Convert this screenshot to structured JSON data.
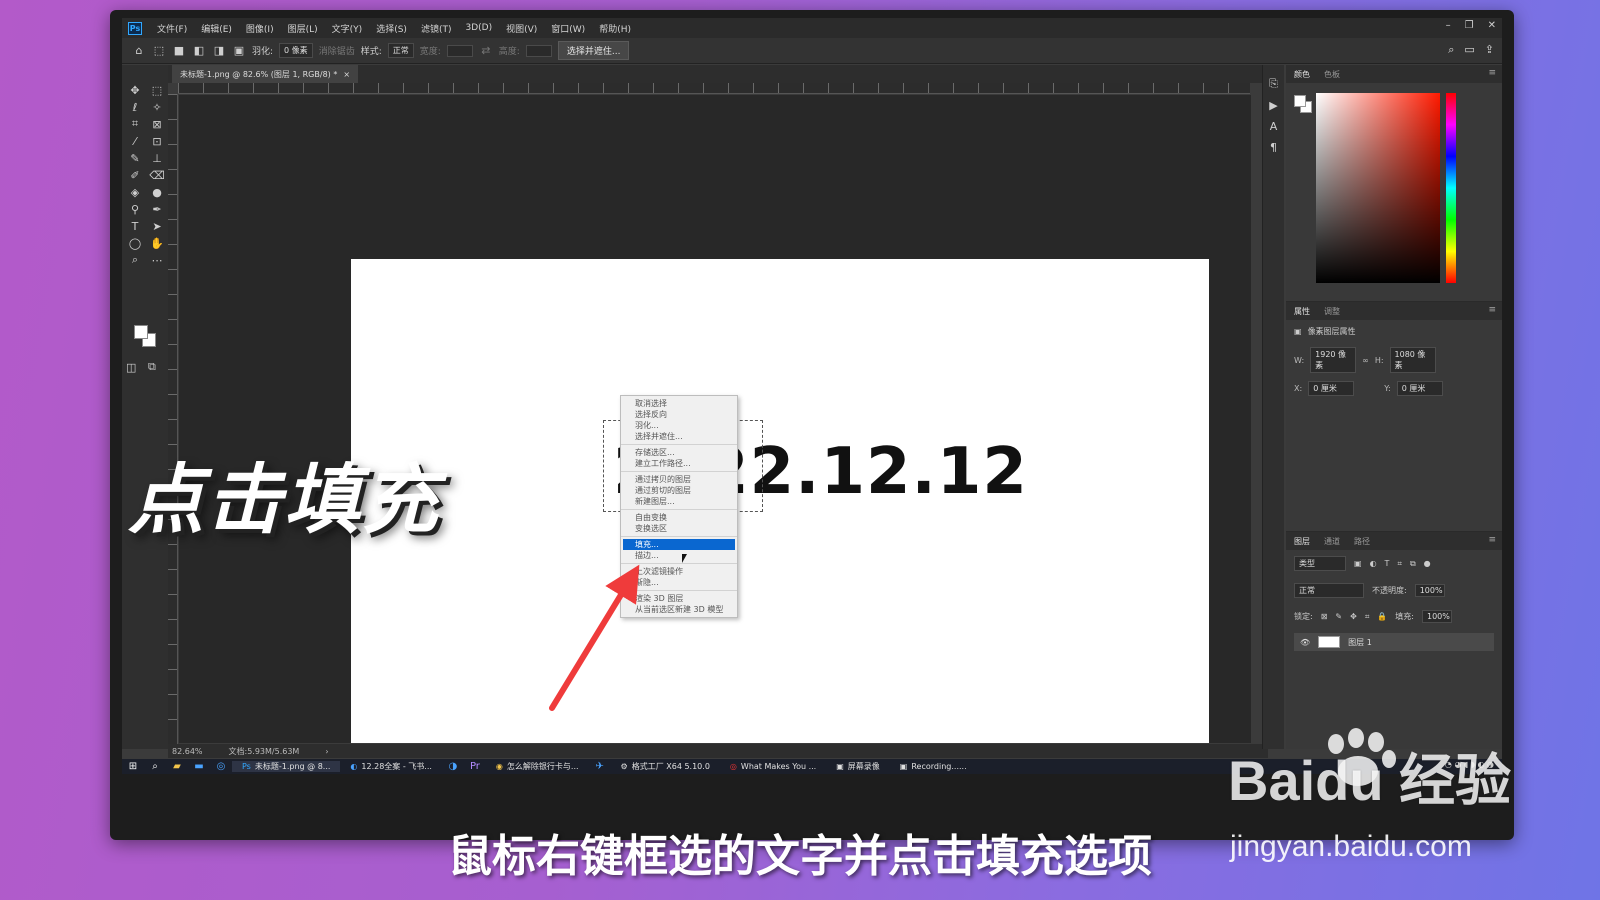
{
  "app": {
    "logo_text": "Ps",
    "menu": [
      "文件(F)",
      "编辑(E)",
      "图像(I)",
      "图层(L)",
      "文字(Y)",
      "选择(S)",
      "滤镜(T)",
      "3D(D)",
      "视图(V)",
      "窗口(W)",
      "帮助(H)"
    ]
  },
  "options_bar": {
    "feather_label": "羽化:",
    "feather_value": "0 像素",
    "antialias_label": "消除锯齿",
    "style_label": "样式:",
    "style_value": "正常",
    "width_label": "宽度:",
    "height_label": "高度:",
    "select_mask_button": "选择并遮住..."
  },
  "document": {
    "tab_title": "未标题-1.png @ 82.6% (图层 1, RGB/8) *",
    "canvas_text": "2022.12.12"
  },
  "context_menu": {
    "groups": [
      [
        "取消选择",
        "选择反向",
        "羽化...",
        "选择并遮住..."
      ],
      [
        "存储选区...",
        "建立工作路径..."
      ],
      [
        "通过拷贝的图层",
        "通过剪切的图层",
        "新建图层..."
      ],
      [
        "自由变换",
        "变换选区"
      ],
      [
        "填充...",
        "描边..."
      ],
      [
        "上次滤镜操作",
        "渐隐..."
      ],
      [
        "渲染 3D 图层",
        "从当前选区新建 3D 模型"
      ]
    ],
    "highlighted": "填充..."
  },
  "status": {
    "zoom": "82.64%",
    "doc_info": "文档:5.93M/5.63M"
  },
  "panels": {
    "color_tabs": [
      "颜色",
      "色板"
    ],
    "properties_tabs": [
      "属性",
      "调整"
    ],
    "properties_title": "像素图层属性",
    "w_label": "W:",
    "w_value": "1920 像素",
    "h_label": "H:",
    "h_value": "1080 像素",
    "x_label": "X:",
    "x_value": "0 厘米",
    "y_label": "Y:",
    "y_value": "0 厘米",
    "layers_tabs": [
      "图层",
      "通道",
      "路径"
    ],
    "kind_label": "类型",
    "blend_mode": "正常",
    "opacity_label": "不透明度:",
    "opacity_value": "100%",
    "lock_label": "锁定:",
    "fill_label": "填充:",
    "fill_value": "100%",
    "layer_name": "图层 1"
  },
  "taskbar": {
    "apps": [
      "未标题-1.png @ 8...",
      "12.28全案 - 飞书...",
      "怎么解除银行卡与...",
      "格式工厂 X64 5.10.0",
      "What Makes You ...",
      "屏幕录像",
      "Recording......"
    ]
  },
  "overlay": {
    "left_text": "点击填充",
    "caption": "鼠标右键框选的文字并点击填充选项",
    "watermark": "Baidu 经验",
    "watermark_url": "jingyan.baidu.com"
  },
  "colors": {
    "highlight": "#0a67d0",
    "arrow": "#ef3b3b",
    "ps_blue": "#31a8ff"
  }
}
